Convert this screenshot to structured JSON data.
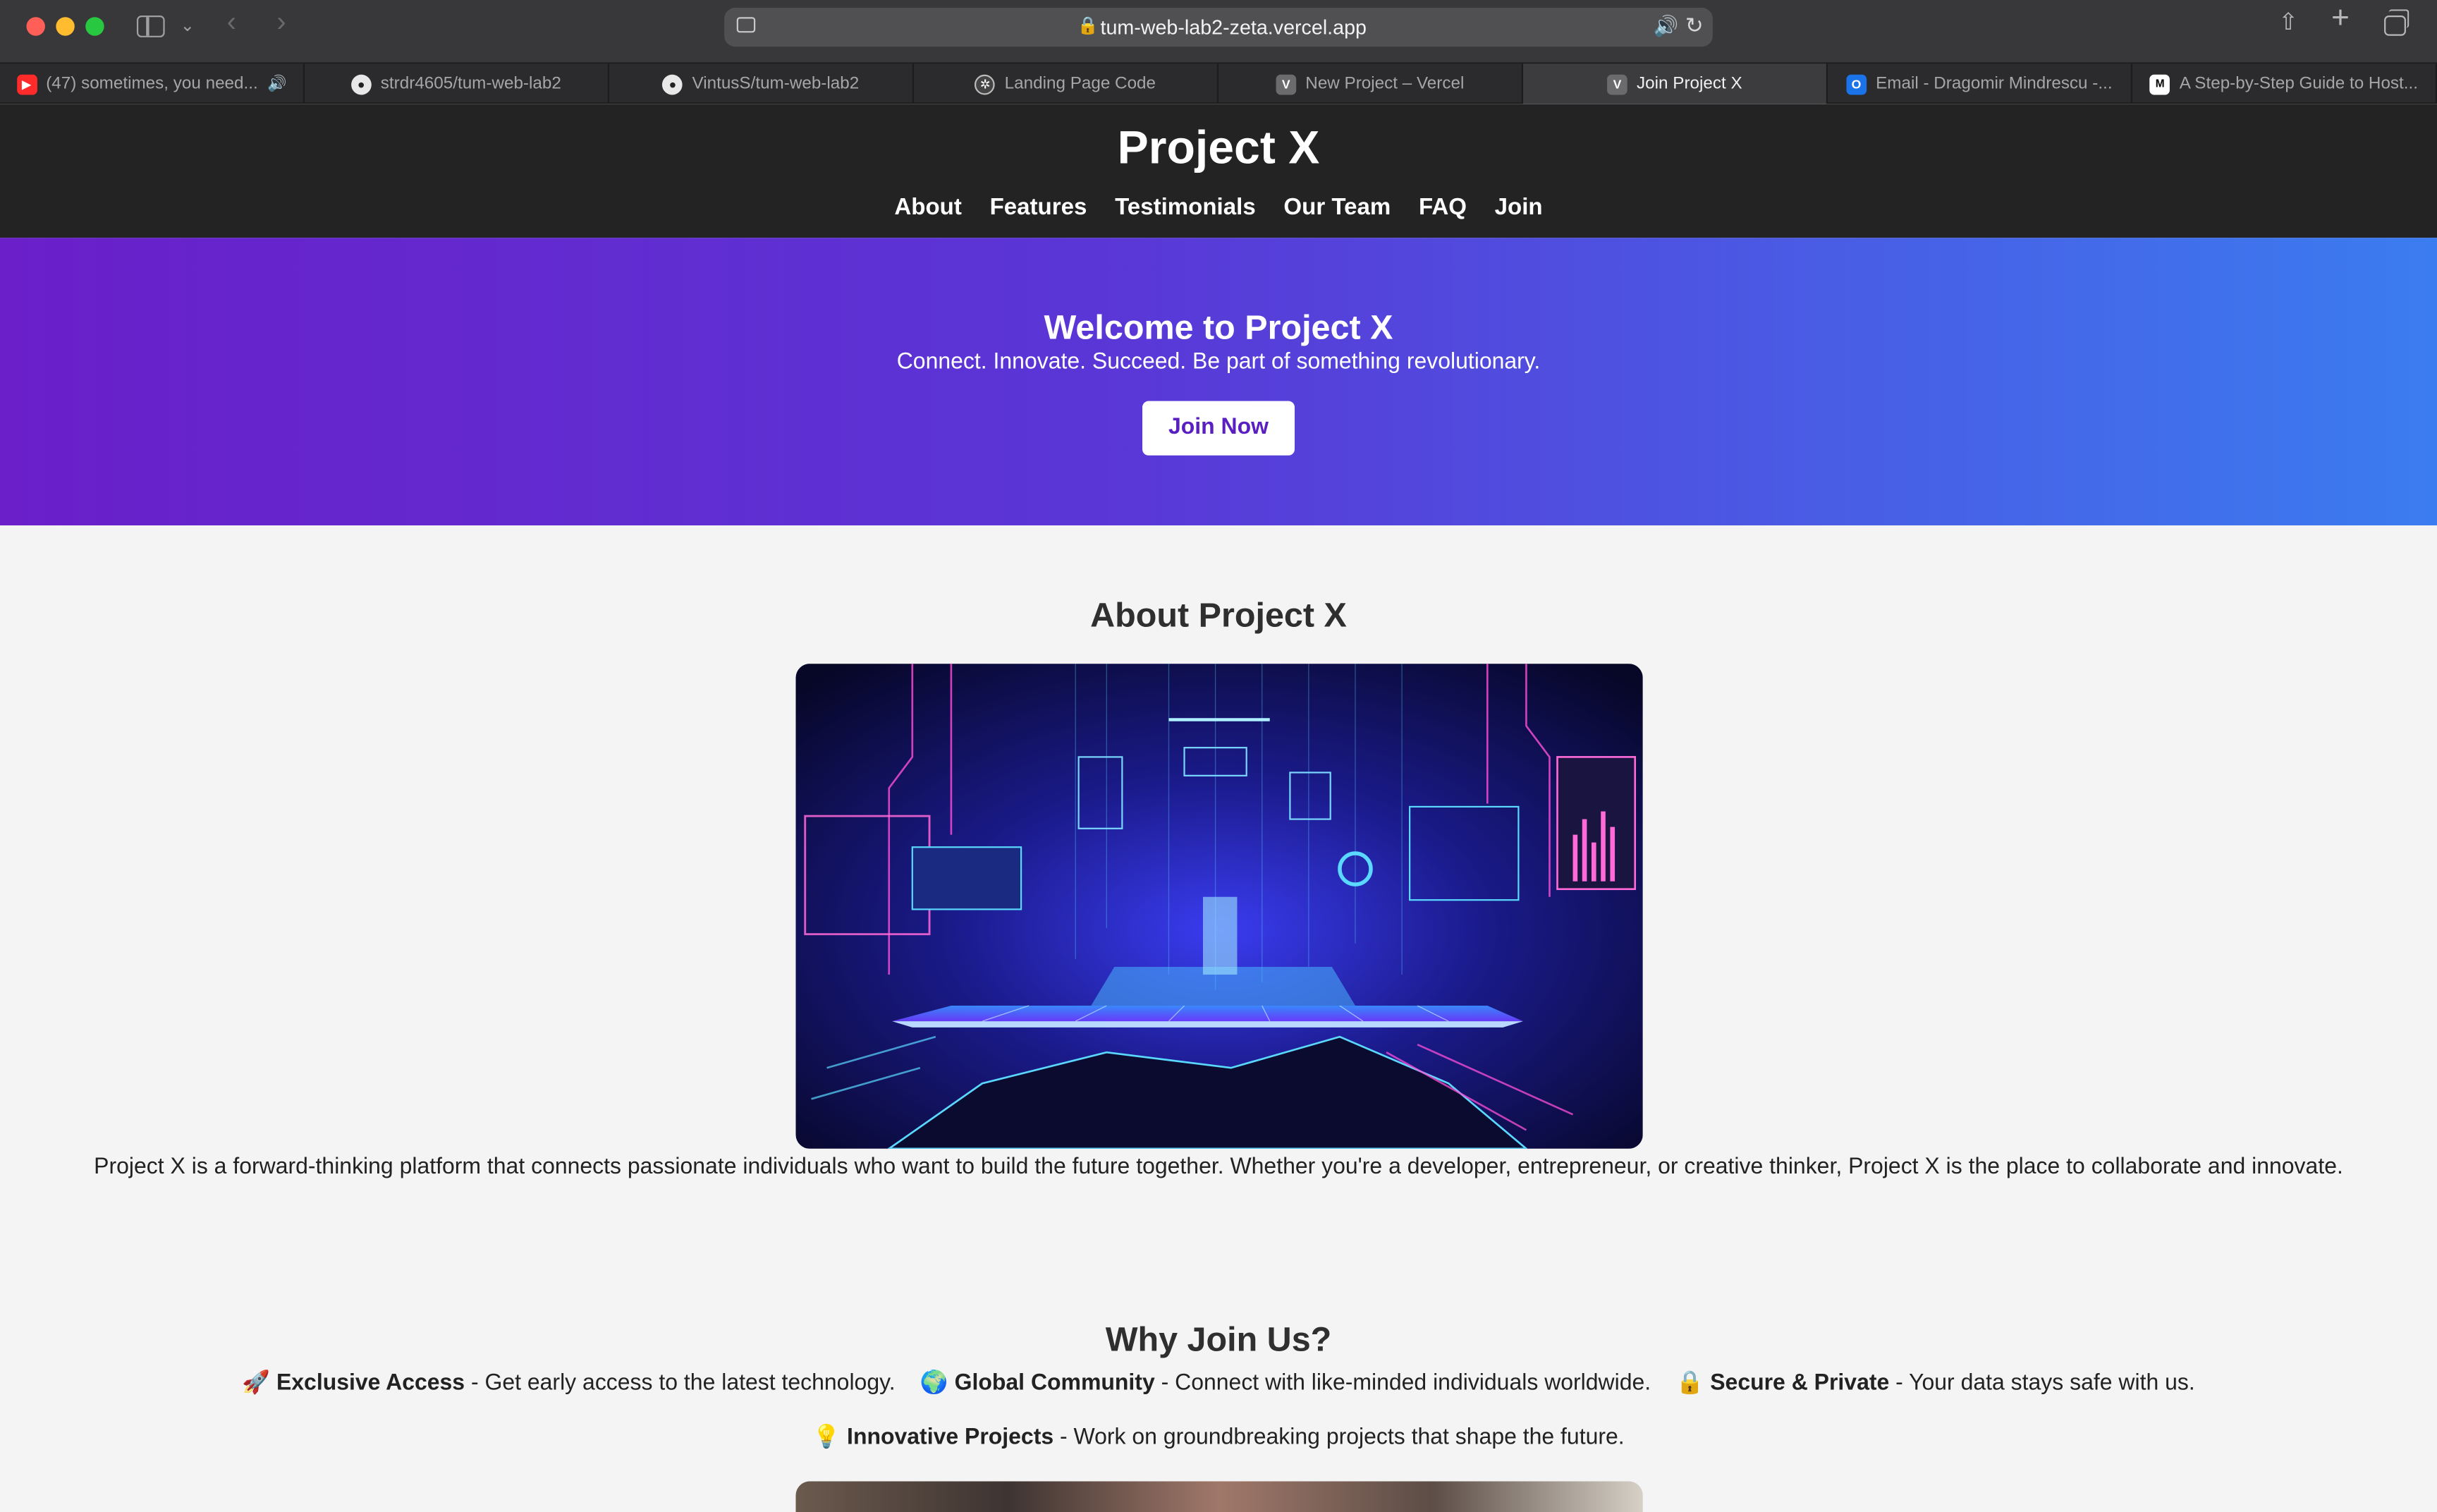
{
  "browser": {
    "url": "tum-web-lab2-zeta.vercel.app",
    "tabs": [
      {
        "label": "(47) sometimes, you need...",
        "favicon": "youtube-icon",
        "active": false,
        "audio": true
      },
      {
        "label": "strdr4605/tum-web-lab2",
        "favicon": "github-icon",
        "active": false
      },
      {
        "label": "VintusS/tum-web-lab2",
        "favicon": "github-icon",
        "active": false
      },
      {
        "label": "Landing Page Code",
        "favicon": "chatgpt-icon",
        "active": false
      },
      {
        "label": "New Project – Vercel",
        "favicon": "vercel-icon",
        "active": false
      },
      {
        "label": "Join Project X",
        "favicon": "vercel-icon",
        "active": true
      },
      {
        "label": "Email - Dragomir Mindrescu -...",
        "favicon": "outlook-icon",
        "active": false
      },
      {
        "label": "A Step-by-Step Guide to Host...",
        "favicon": "medium-icon",
        "active": false
      }
    ]
  },
  "site": {
    "title": "Project X",
    "nav": [
      "About",
      "Features",
      "Testimonials",
      "Our Team",
      "FAQ",
      "Join"
    ]
  },
  "hero": {
    "heading": "Welcome to Project X",
    "tagline": "Connect. Innovate. Succeed. Be part of something revolutionary.",
    "button": "Join Now"
  },
  "about": {
    "heading": "About Project X",
    "text": "Project X is a forward-thinking platform that connects passionate individuals who want to build the future together. Whether you're a developer, entrepreneur, or creative thinker, Project X is the place to collaborate and innovate."
  },
  "why": {
    "heading": "Why Join Us?",
    "items": [
      {
        "emoji": "🚀",
        "title": "Exclusive Access",
        "text": " - Get early access to the latest technology."
      },
      {
        "emoji": "🌍",
        "title": "Global Community",
        "text": " - Connect with like-minded individuals worldwide."
      },
      {
        "emoji": "🔒",
        "title": "Secure & Private",
        "text": " - Your data stays safe with us."
      },
      {
        "emoji": "💡",
        "title": "Innovative Projects",
        "text": " - Work on groundbreaking projects that shape the future."
      }
    ]
  },
  "colors": {
    "header_bg": "#232323",
    "hero_gradient_start": "#6a1fc9",
    "hero_gradient_end": "#3b7cf0",
    "button_text": "#5a1fc0"
  }
}
